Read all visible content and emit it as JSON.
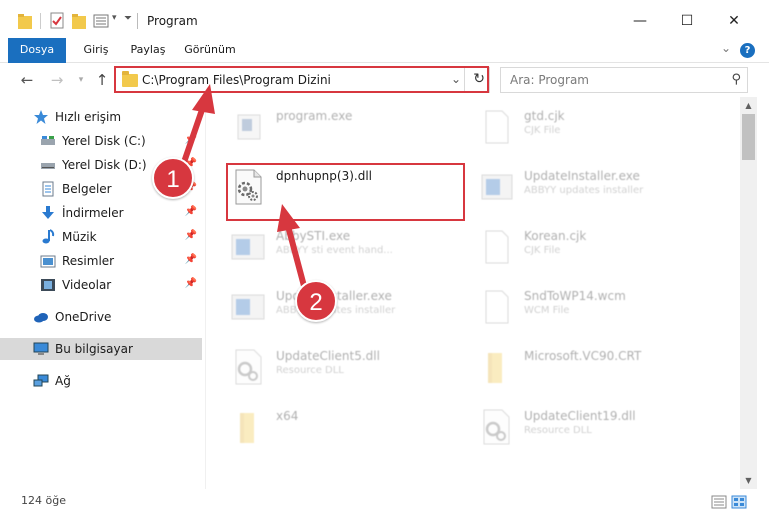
{
  "window": {
    "title": "Program",
    "minimize": "—",
    "maximize": "☐",
    "close": "✕"
  },
  "ribbon": {
    "tabs": [
      "Dosya",
      "Giriş",
      "Paylaş",
      "Görünüm"
    ],
    "help": "?"
  },
  "address": {
    "path": "C:\\Program Files\\Program Dizini",
    "search_placeholder": "Ara: Program"
  },
  "sidebar": {
    "items": [
      {
        "label": "Hızlı erişim",
        "icon": "star-icon"
      },
      {
        "label": "Yerel Disk (C:)",
        "icon": "drive-icon"
      },
      {
        "label": "Yerel Disk (D:)",
        "icon": "drive-icon"
      },
      {
        "label": "Belgeler",
        "icon": "documents-icon"
      },
      {
        "label": "İndirmeler",
        "icon": "download-icon"
      },
      {
        "label": "Müzik",
        "icon": "music-icon"
      },
      {
        "label": "Resimler",
        "icon": "pictures-icon"
      },
      {
        "label": "Videolar",
        "icon": "video-icon"
      },
      {
        "label": "OneDrive",
        "icon": "cloud-icon"
      },
      {
        "label": "Bu bilgisayar",
        "icon": "computer-icon"
      },
      {
        "label": "Ağ",
        "icon": "network-icon"
      }
    ]
  },
  "files": [
    {
      "name": "program.exe",
      "desc": ""
    },
    {
      "name": "gtd.cjk",
      "desc": "CJK File"
    },
    {
      "name": "dpnhupnp(3).dll",
      "desc": ""
    },
    {
      "name": "UpdateInstaller.exe",
      "desc": "ABBYY updates installer"
    },
    {
      "name": "AbbySTI.exe",
      "desc": "ABBYY sti event hand..."
    },
    {
      "name": "Korean.cjk",
      "desc": "CJK File"
    },
    {
      "name": "UpdateInstaller.exe",
      "desc": "ABBYY updates installer"
    },
    {
      "name": "SndToWP14.wcm",
      "desc": "WCM File"
    },
    {
      "name": "UpdateClient5.dll",
      "desc": "Resource DLL"
    },
    {
      "name": "Microsoft.VC90.CRT",
      "desc": ""
    },
    {
      "name": "x64",
      "desc": ""
    },
    {
      "name": "UpdateClient19.dll",
      "desc": "Resource DLL"
    }
  ],
  "status": {
    "count": "124 öğe"
  },
  "annotations": {
    "step1": "1",
    "step2": "2",
    "color": "#d7373f"
  }
}
